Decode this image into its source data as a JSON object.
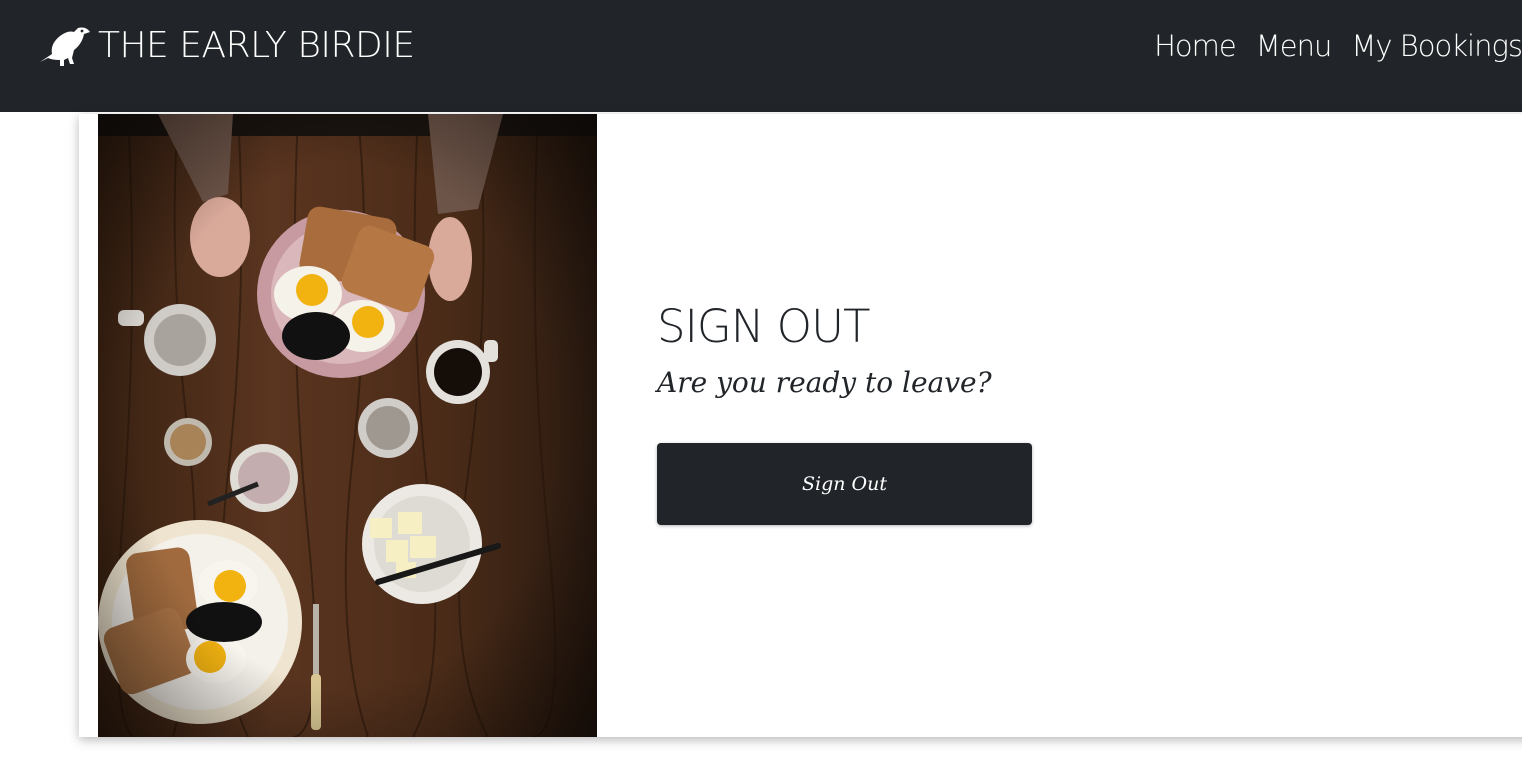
{
  "navbar": {
    "brand_text": "THE EARLY BIRDIE",
    "brand_icon": "bird-icon",
    "links": [
      {
        "label": "Home"
      },
      {
        "label": "Menu"
      },
      {
        "label": "My Bookings"
      }
    ],
    "background": "#212529"
  },
  "main": {
    "image_subject": "breakfast-table-photo",
    "title": "SIGN OUT",
    "subtitle": "Are you ready to leave?",
    "button_label": "Sign Out",
    "button_color": "#212529"
  }
}
